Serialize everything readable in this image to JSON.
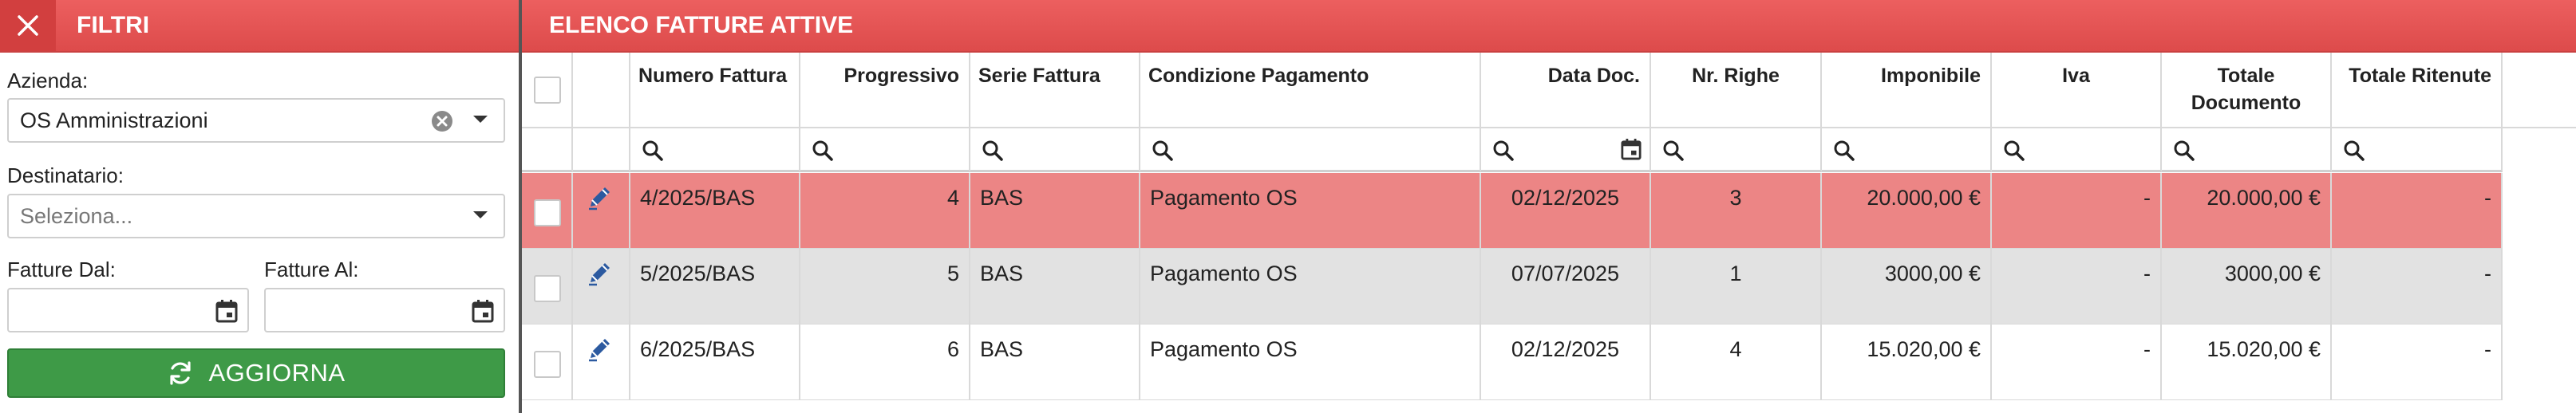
{
  "filters": {
    "title": "FILTRI",
    "azienda_label": "Azienda:",
    "azienda_value": "OS Amministrazioni",
    "destinatario_label": "Destinatario:",
    "destinatario_placeholder": "Seleziona...",
    "fatture_dal_label": "Fatture Dal:",
    "fatture_al_label": "Fatture Al:",
    "fatture_dal_value": "",
    "fatture_al_value": "",
    "aggiorna_label": "AGGIORNA"
  },
  "list": {
    "title": "ELENCO FATTURE ATTIVE",
    "columns": [
      {
        "key": "numero",
        "label": "Numero Fattura"
      },
      {
        "key": "progressivo",
        "label": "Progressivo"
      },
      {
        "key": "serie",
        "label": "Serie Fattura"
      },
      {
        "key": "condizione",
        "label": "Condizione Pagamento"
      },
      {
        "key": "data",
        "label": "Data Doc."
      },
      {
        "key": "righe",
        "label": "Nr. Righe"
      },
      {
        "key": "imponibile",
        "label": "Imponibile"
      },
      {
        "key": "iva",
        "label": "Iva"
      },
      {
        "key": "totale",
        "label": "Totale Documento"
      },
      {
        "key": "ritenute",
        "label": "Totale Ritenute"
      }
    ],
    "rows": [
      {
        "numero": "4/2025/BAS",
        "progressivo": "4",
        "serie": "BAS",
        "condizione": "Pagamento OS",
        "data": "02/12/2025",
        "righe": "3",
        "imponibile": "20.000,00 €",
        "iva": "-",
        "totale": "20.000,00 €",
        "ritenute": "-",
        "highlight": "selected"
      },
      {
        "numero": "5/2025/BAS",
        "progressivo": "5",
        "serie": "BAS",
        "condizione": "Pagamento OS",
        "data": "07/07/2025",
        "righe": "1",
        "imponibile": "3000,00 €",
        "iva": "-",
        "totale": "3000,00 €",
        "ritenute": "-",
        "highlight": "alt"
      },
      {
        "numero": "6/2025/BAS",
        "progressivo": "6",
        "serie": "BAS",
        "condizione": "Pagamento OS",
        "data": "02/12/2025",
        "righe": "4",
        "imponibile": "15.020,00 €",
        "iva": "-",
        "totale": "15.020,00 €",
        "ritenute": "-",
        "highlight": "none"
      }
    ]
  },
  "colors": {
    "header_red": "#e05050",
    "selected_row": "#ec8585",
    "alt_row": "#e2e2e2",
    "button_green": "#3e9a47",
    "edit_icon_blue": "#2c5aa0"
  },
  "icons": {
    "close": "close-icon",
    "clear": "clear-circle-icon",
    "dropdown": "chevron-down-icon",
    "calendar": "calendar-icon",
    "refresh": "refresh-icon",
    "search": "search-icon",
    "edit": "pencil-icon"
  }
}
